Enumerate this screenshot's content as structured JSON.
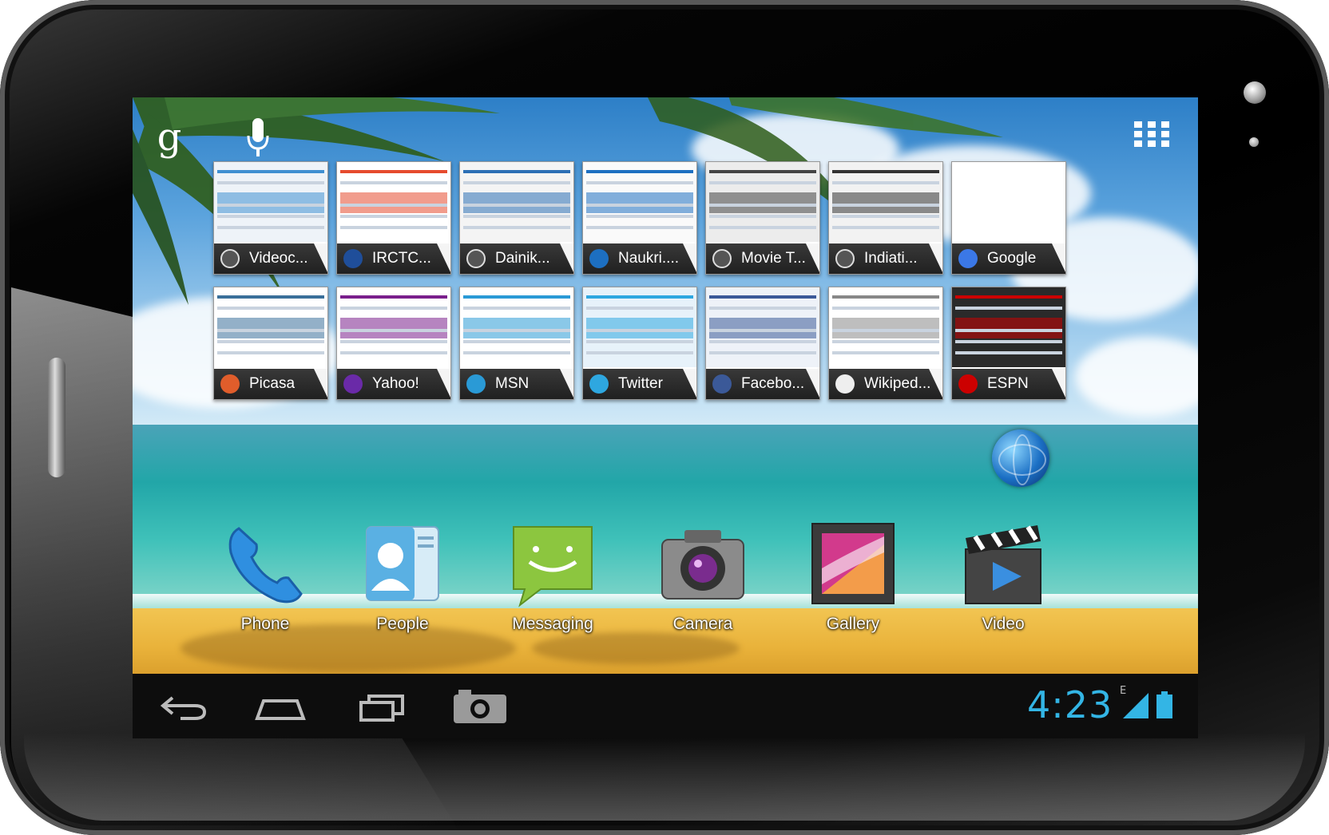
{
  "device": {
    "type": "android-tablet"
  },
  "top_bar": {
    "search_icon": "google-search-icon",
    "voice_icon": "microphone-icon",
    "apps_icon": "all-apps-grid-icon"
  },
  "bookmarks": [
    {
      "label": "Videoc...",
      "favicon": "globe-icon"
    },
    {
      "label": "IRCTC...",
      "favicon": "irctc-icon"
    },
    {
      "label": "Dainik...",
      "favicon": "globe-icon"
    },
    {
      "label": "Naukri....",
      "favicon": "naukri-icon"
    },
    {
      "label": "Movie T...",
      "favicon": "globe-icon"
    },
    {
      "label": "Indiati...",
      "favicon": "globe-icon"
    },
    {
      "label": "Google",
      "favicon": "google-icon"
    },
    {
      "label": "Picasa",
      "favicon": "picasa-icon"
    },
    {
      "label": "Yahoo!",
      "favicon": "yahoo-icon"
    },
    {
      "label": "MSN",
      "favicon": "msn-icon"
    },
    {
      "label": "Twitter",
      "favicon": "twitter-icon"
    },
    {
      "label": "Facebo...",
      "favicon": "facebook-icon"
    },
    {
      "label": "Wikiped...",
      "favicon": "wikipedia-icon"
    },
    {
      "label": "ESPN",
      "favicon": "espn-icon"
    }
  ],
  "browser_widget_icon": "browser-globe-icon",
  "dock": [
    {
      "label": "Phone",
      "icon": "phone-icon"
    },
    {
      "label": "People",
      "icon": "contacts-icon"
    },
    {
      "label": "Messaging",
      "icon": "messaging-icon"
    },
    {
      "label": "Camera",
      "icon": "camera-icon"
    },
    {
      "label": "Gallery",
      "icon": "gallery-icon"
    },
    {
      "label": "Video",
      "icon": "video-icon"
    }
  ],
  "nav": {
    "back": "back-icon",
    "home": "home-icon",
    "recents": "recent-apps-icon",
    "screenshot": "screenshot-camera-icon"
  },
  "status": {
    "time": "4:23",
    "network": "E",
    "signal_icon": "signal-strength-icon",
    "battery_icon": "battery-icon"
  },
  "colors": {
    "clock": "#33b5e5",
    "navbar": "#0d0d0d"
  }
}
